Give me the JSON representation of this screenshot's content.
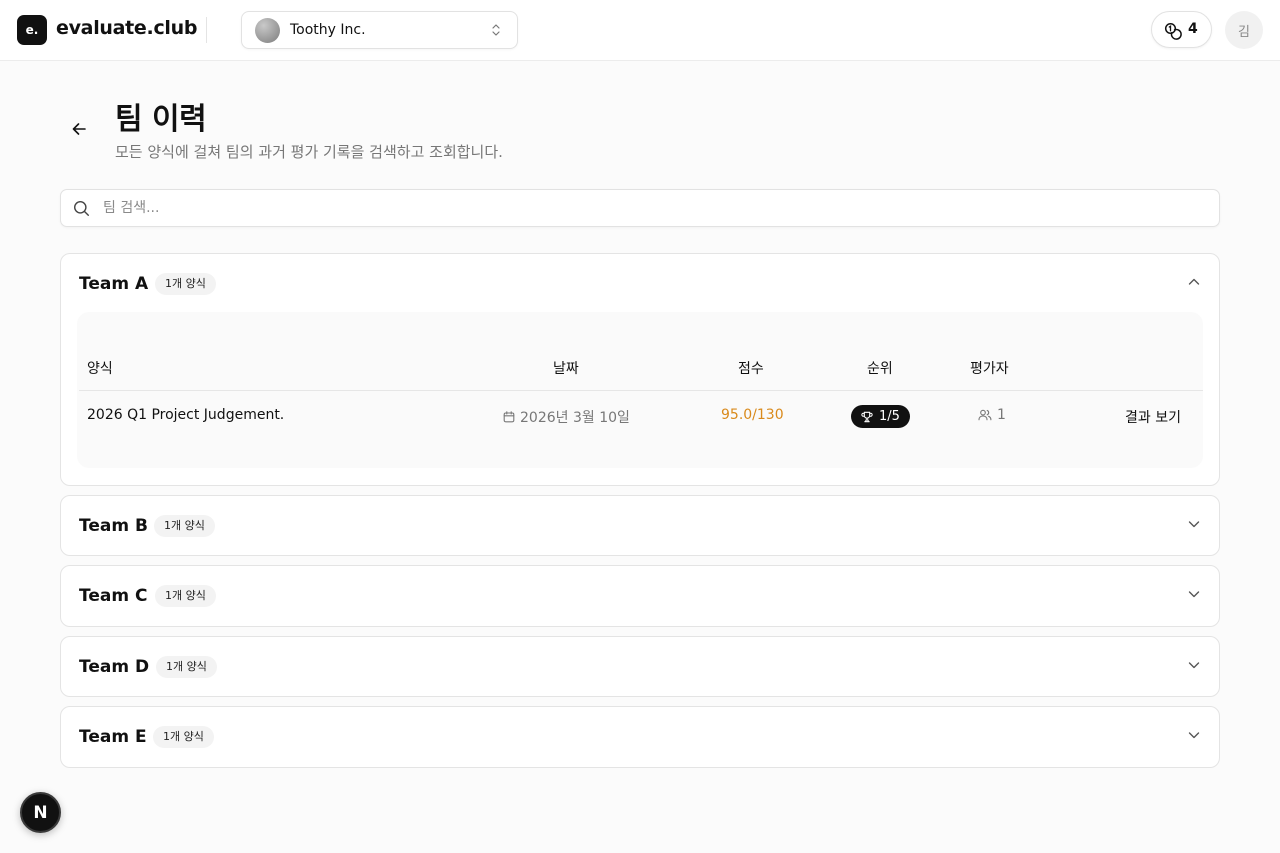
{
  "header": {
    "logo_mark": "e.",
    "logo_text": "evaluate.club",
    "org_name": "Toothy Inc.",
    "credits": "4",
    "user_initial": "김"
  },
  "page": {
    "title": "팀 이력",
    "subtitle": "모든 양식에 걸쳐 팀의 과거 평가 기록을 검색하고 조회합니다."
  },
  "search": {
    "placeholder": "팀 검색...",
    "value": ""
  },
  "table_headers": {
    "form": "양식",
    "date": "날짜",
    "score": "점수",
    "rank": "순위",
    "evaluators": "평가자"
  },
  "teams": [
    {
      "name": "Team A",
      "badge": "1개 양식",
      "expanded": true,
      "rows": [
        {
          "form": "2026 Q1 Project Judgement.",
          "date": "2026년 3월 10일",
          "score": "95.0/130",
          "rank": "1/5",
          "evaluators": "1",
          "action": "결과 보기"
        }
      ]
    },
    {
      "name": "Team B",
      "badge": "1개 양식",
      "expanded": false
    },
    {
      "name": "Team C",
      "badge": "1개 양식",
      "expanded": false
    },
    {
      "name": "Team D",
      "badge": "1개 양식",
      "expanded": false
    },
    {
      "name": "Team E",
      "badge": "1개 양식",
      "expanded": false
    }
  ],
  "dev_indicator": "N",
  "colors": {
    "score": "#d98a1c",
    "rank_pill": "#111111",
    "badge_bg": "#f3f3f3"
  }
}
